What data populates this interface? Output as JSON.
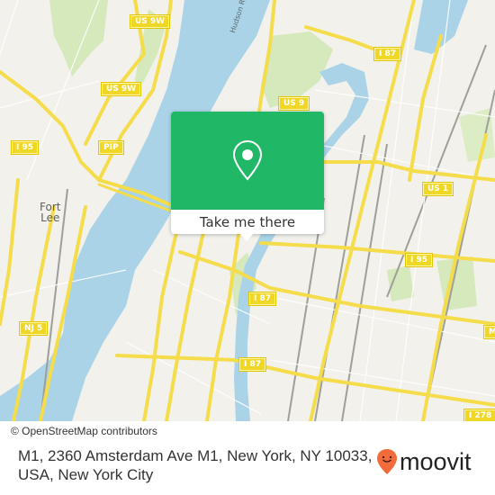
{
  "map": {
    "road_shields": [
      {
        "id": "us9w-top",
        "label": "US 9W"
      },
      {
        "id": "us9w-mid",
        "label": "US 9W"
      },
      {
        "id": "i95-left",
        "label": "I 95"
      },
      {
        "id": "pip",
        "label": "PIP"
      },
      {
        "id": "i87-top",
        "label": "I 87"
      },
      {
        "id": "us9",
        "label": "US 9"
      },
      {
        "id": "us1",
        "label": "US 1"
      },
      {
        "id": "i95-right",
        "label": "I 95"
      },
      {
        "id": "i87-mid",
        "label": "I 87"
      },
      {
        "id": "i87-low",
        "label": "I 87"
      },
      {
        "id": "nj5",
        "label": "NJ 5"
      },
      {
        "id": "i278",
        "label": "I 278"
      },
      {
        "id": "edge-cut",
        "label": "M"
      }
    ],
    "place_labels": [
      {
        "id": "fort-lee",
        "label": "Fort\nLee"
      }
    ],
    "water_labels": [
      {
        "id": "hudson-river",
        "label": "Hudson R"
      }
    ],
    "colors": {
      "land": "#f2f1ec",
      "water": "#a8d8ec",
      "park": "#cfe6b0",
      "road_major": "#f7e56a",
      "road_outline": "#e8cf3a",
      "rail": "#9a9a9a"
    }
  },
  "popup": {
    "icon": "map-pin-icon",
    "button_label": "Take me there",
    "color": "#20b866"
  },
  "attribution": {
    "text": "© OpenStreetMap contributors"
  },
  "footer": {
    "address": "M1, 2360 Amsterdam Ave M1, New York, NY 10033, USA, New York City",
    "brand": {
      "icon": "moovit-pin-icon",
      "name": "moovit",
      "color": "#f26b3a"
    }
  }
}
